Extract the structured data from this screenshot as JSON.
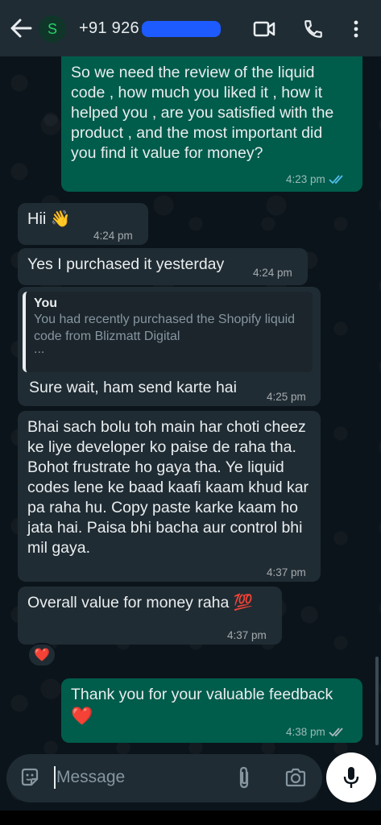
{
  "header": {
    "avatar_letter": "S",
    "contact": "+91 926"
  },
  "messages": [
    {
      "text": "So we need the review of the liquid code , how much you liked it , how it helped you , are you satisfied with the product , and the most important did you find it value for money?",
      "time": "4:23 pm",
      "status": "read"
    },
    {
      "text": "Hii 👋",
      "time": "4:24 pm"
    },
    {
      "text": "Yes I purchased it yesterday",
      "time": "4:24 pm"
    },
    {
      "quote_author": "You",
      "quote_text": "You had recently purchased the Shopify liquid code from Blizmatt Digital",
      "quote_more": "...",
      "text": "Sure wait, ham send karte hai",
      "time": "4:25 pm"
    },
    {
      "text": "Bhai sach bolu toh main har choti cheez ke liye developer ko paise de raha tha. Bohot frustrate ho gaya tha. Ye liquid codes lene ke baad kaafi kaam khud kar pa raha hu. Copy paste karke kaam ho jata hai. Paisa bhi bacha aur control bhi mil gaya.",
      "time": "4:37 pm"
    },
    {
      "text": "Overall value for money raha 💯",
      "time": "4:37 pm",
      "reaction": "❤️"
    },
    {
      "text": "Thank you for your valuable feedback",
      "emoji": "❤️",
      "time": "4:38 pm",
      "status": "sent"
    }
  ],
  "composer": {
    "placeholder": "Message"
  },
  "colors": {
    "outgoing": "#005c4b",
    "incoming": "#202c33",
    "read_tick": "#53bdeb",
    "accent": "#25d366"
  }
}
